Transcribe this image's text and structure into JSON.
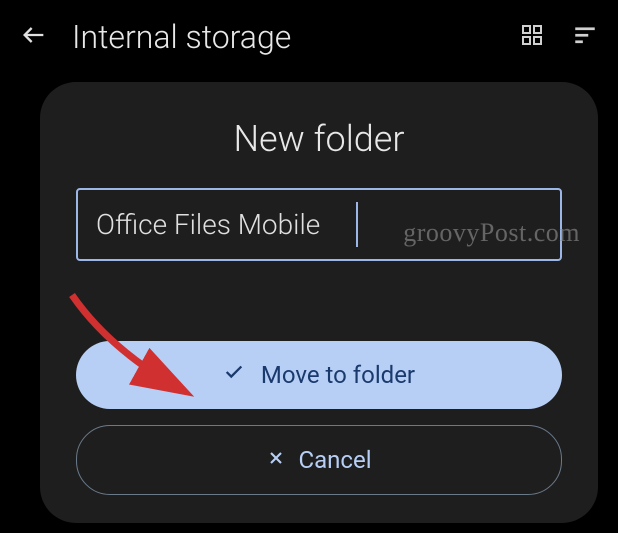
{
  "header": {
    "title": "Internal storage"
  },
  "dialog": {
    "title": "New folder",
    "input_value": "Office Files Mobile",
    "primary_label": "Move to folder",
    "secondary_label": "Cancel"
  },
  "watermark": "groovyPost.com"
}
